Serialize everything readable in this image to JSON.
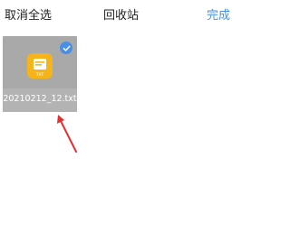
{
  "header": {
    "select_all_cancel": "取消全选",
    "title": "回收站",
    "done": "完成"
  },
  "files": [
    {
      "name": "20210212_12.txt",
      "type_label": "TXT",
      "selected": true
    }
  ],
  "colors": {
    "accent": "#4a90e2",
    "card_bg": "#a9a9a9",
    "icon_bg": "#f5b41a",
    "annotation_arrow": "#e3302f"
  }
}
